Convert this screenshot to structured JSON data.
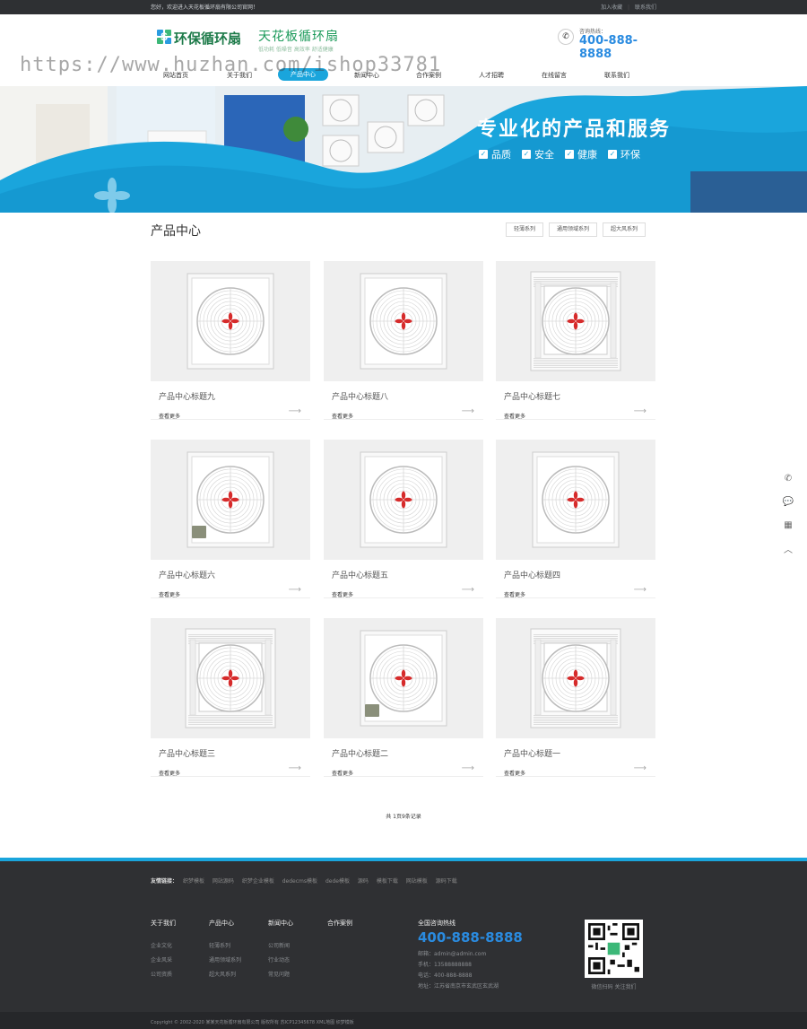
{
  "topbar": {
    "welcome": "您好，欢迎进入天花板循环扇有限公司官网！",
    "links": [
      "加入收藏",
      "联系我们"
    ]
  },
  "logo": {
    "name": "环保循环扇",
    "sub": "天花板循环扇",
    "slogan": "低功耗 低噪音 高效率 舒适健康"
  },
  "hotline": {
    "label": "咨询热线：",
    "number": "400-888-8888"
  },
  "nav": {
    "items": [
      "网站首页",
      "关于我们",
      "产品中心",
      "新闻中心",
      "合作案例",
      "人才招聘",
      "在线留言",
      "联系我们"
    ],
    "active_index": 2
  },
  "watermark": "https://www.huzhan.com/ishop33781",
  "banner": {
    "title": "专业化的产品和服务",
    "tags": [
      "品质",
      "安全",
      "健康",
      "环保"
    ]
  },
  "section": {
    "title": "产品中心",
    "filters": [
      "轻薄系列",
      "通用领域系列",
      "超大风系列"
    ]
  },
  "products": [
    {
      "name": "产品中心标题九",
      "more": "查看更多",
      "style": "square"
    },
    {
      "name": "产品中心标题八",
      "more": "查看更多",
      "style": "square"
    },
    {
      "name": "产品中心标题七",
      "more": "查看更多",
      "style": "grille"
    },
    {
      "name": "产品中心标题六",
      "more": "查看更多",
      "style": "square-badge"
    },
    {
      "name": "产品中心标题五",
      "more": "查看更多",
      "style": "square"
    },
    {
      "name": "产品中心标题四",
      "more": "查看更多",
      "style": "square"
    },
    {
      "name": "产品中心标题三",
      "more": "查看更多",
      "style": "grille"
    },
    {
      "name": "产品中心标题二",
      "more": "查看更多",
      "style": "square-badge"
    },
    {
      "name": "产品中心标题一",
      "more": "查看更多",
      "style": "grille"
    }
  ],
  "pager": "共 1页9条记录",
  "footer": {
    "friend_label": "友情链接：",
    "friend_links": [
      "织梦模板",
      "网站源码",
      "织梦企业模板",
      "dedecms模板",
      "dede模板",
      "源码",
      "模板下载",
      "网站模板",
      "源码下载"
    ],
    "columns": [
      {
        "title": "关于我们",
        "items": [
          "企业文化",
          "企业风采",
          "公司资质"
        ]
      },
      {
        "title": "产品中心",
        "items": [
          "轻薄系列",
          "通用领域系列",
          "超大风系列"
        ]
      },
      {
        "title": "新闻中心",
        "items": [
          "公司新闻",
          "行业动态",
          "常见问题"
        ]
      },
      {
        "title": "合作案例",
        "items": []
      }
    ],
    "contact": {
      "title": "全国咨询热线",
      "number": "400-888-8888",
      "lines": [
        "邮箱：admin@admin.com",
        "手机：13588888888",
        "电话：400-888-8888",
        "地址：江苏省南京市玄武区玄武湖"
      ]
    },
    "qr_caption": "微信扫码 关注我们",
    "copyright": "Copyright © 2002-2020 某某天花板循环扇有限公司 版权所有    苏ICP12345678    XML地图    织梦模板"
  },
  "colors": {
    "accent": "#1aa5dc",
    "hotline": "#2a8be0",
    "footer_bg": "#2f3033",
    "topbar_bg": "#2e3033"
  },
  "side_icons": [
    "phone-icon",
    "chat-icon",
    "qrcode-icon",
    "back-to-top-icon"
  ]
}
